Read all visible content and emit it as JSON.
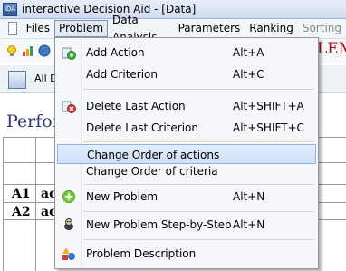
{
  "window": {
    "title": "interactive Decision Aid - [Data]",
    "app_icon_text": "iDA"
  },
  "menubar": {
    "items": [
      "Files",
      "Problem",
      "Data Analysis",
      "Parameters",
      "Ranking",
      "Sorting"
    ],
    "active": "Problem",
    "disabled": [
      "Sorting"
    ]
  },
  "background": {
    "heading_fragment": "LEM",
    "tab_label": "All Da",
    "performance_title": "Perfor",
    "rows": [
      {
        "label": "A1",
        "value": "ac"
      },
      {
        "label": "A2",
        "value": "ac"
      }
    ]
  },
  "problem_menu": {
    "items": [
      {
        "label": "Add Action",
        "shortcut": "Alt+A",
        "icon": "add-action-icon"
      },
      {
        "label": "Add Criterion",
        "shortcut": "Alt+C",
        "icon": ""
      },
      {
        "label": "Delete Last Action",
        "shortcut": "Alt+SHIFT+A",
        "icon": "delete-action-icon"
      },
      {
        "label": "Delete Last Criterion",
        "shortcut": "Alt+SHIFT+C",
        "icon": ""
      },
      {
        "label": "Change Order of actions",
        "shortcut": "",
        "icon": "",
        "highlighted": true
      },
      {
        "label": "Change Order of criteria",
        "shortcut": "",
        "icon": ""
      },
      {
        "label": "New Problem",
        "shortcut": "Alt+N",
        "icon": "new-problem-icon"
      },
      {
        "label": "New Problem Step-by-Step",
        "shortcut": "Alt+N",
        "icon": "wizard-dog-icon"
      },
      {
        "label": "Problem Description",
        "shortcut": "",
        "icon": "shapes-icon"
      }
    ]
  },
  "colors": {
    "highlight": "#cde0f8",
    "heading_red": "#a80e0e",
    "perf_title_blue": "#2d3a72"
  }
}
